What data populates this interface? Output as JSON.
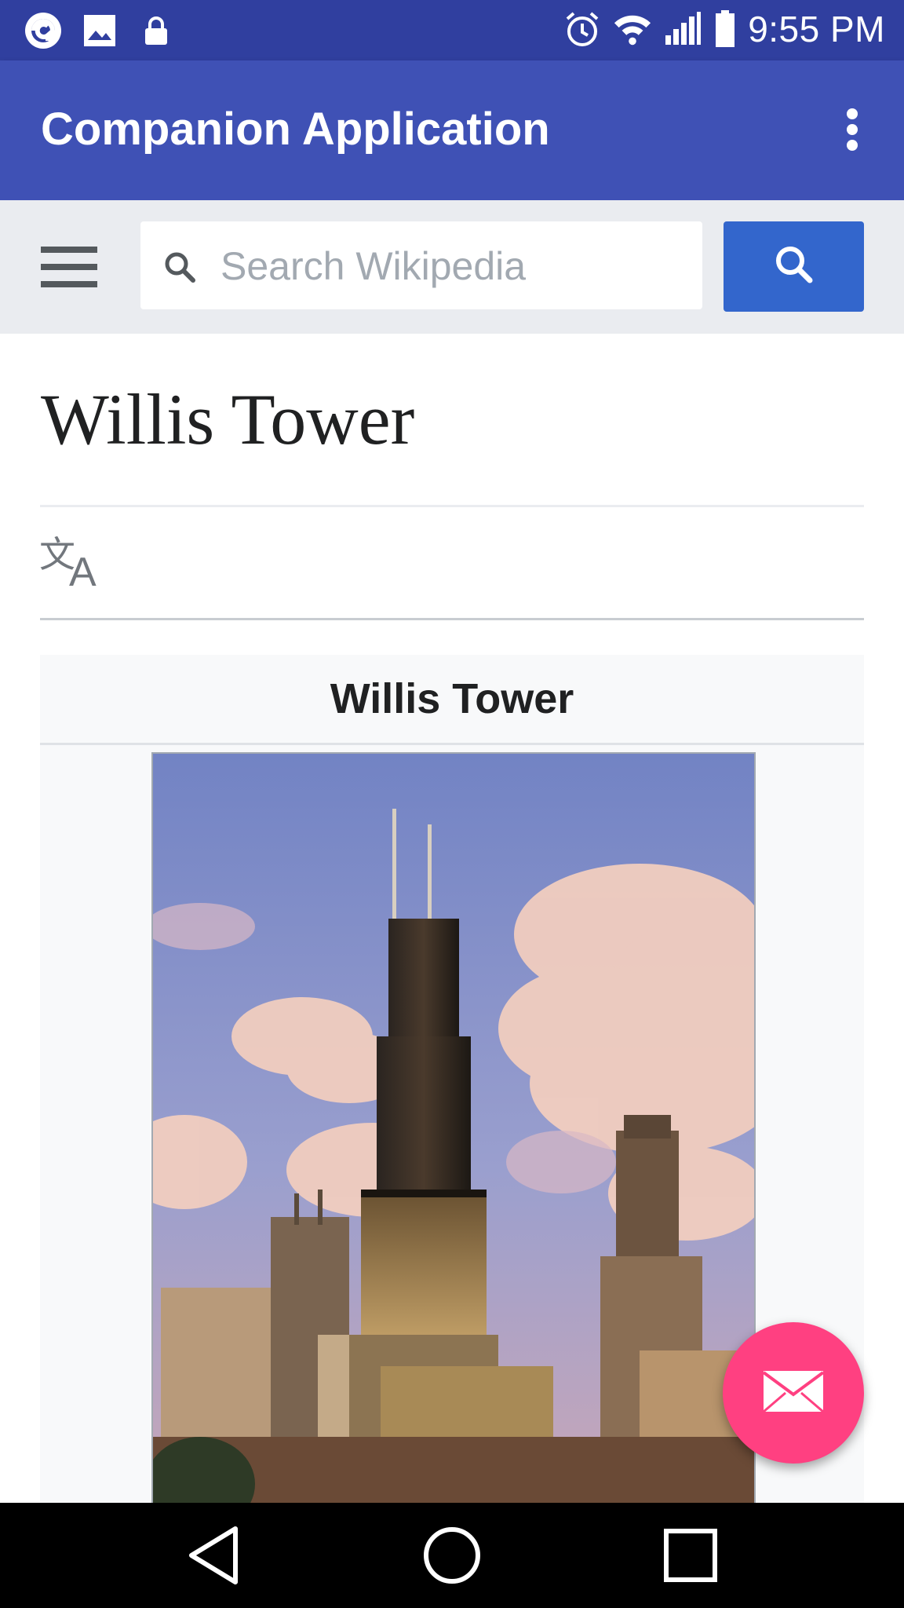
{
  "status_bar": {
    "time": "9:55 PM",
    "left_icons": [
      "app-notification-icon",
      "image-icon",
      "lock-icon"
    ],
    "right_icons": [
      "alarm-icon",
      "wifi-icon",
      "signal-icon",
      "battery-icon"
    ]
  },
  "app_bar": {
    "title": "Companion Application",
    "overflow_icon": "more-vert-icon"
  },
  "search": {
    "placeholder": "Search Wikipedia",
    "value": "",
    "button_icon": "search-icon"
  },
  "article": {
    "title": "Willis Tower",
    "language_icon": "translate-icon",
    "infobox": {
      "title": "Willis Tower",
      "image_subject": "Willis Tower skyline photo"
    }
  },
  "fab": {
    "icon": "mail-icon"
  },
  "nav_bar": {
    "buttons": [
      "back-icon",
      "home-icon",
      "recents-icon"
    ]
  },
  "colors": {
    "status_bar": "#303f9f",
    "app_bar": "#3f51b5",
    "search_button": "#3366cc",
    "fab": "#ff4081"
  }
}
